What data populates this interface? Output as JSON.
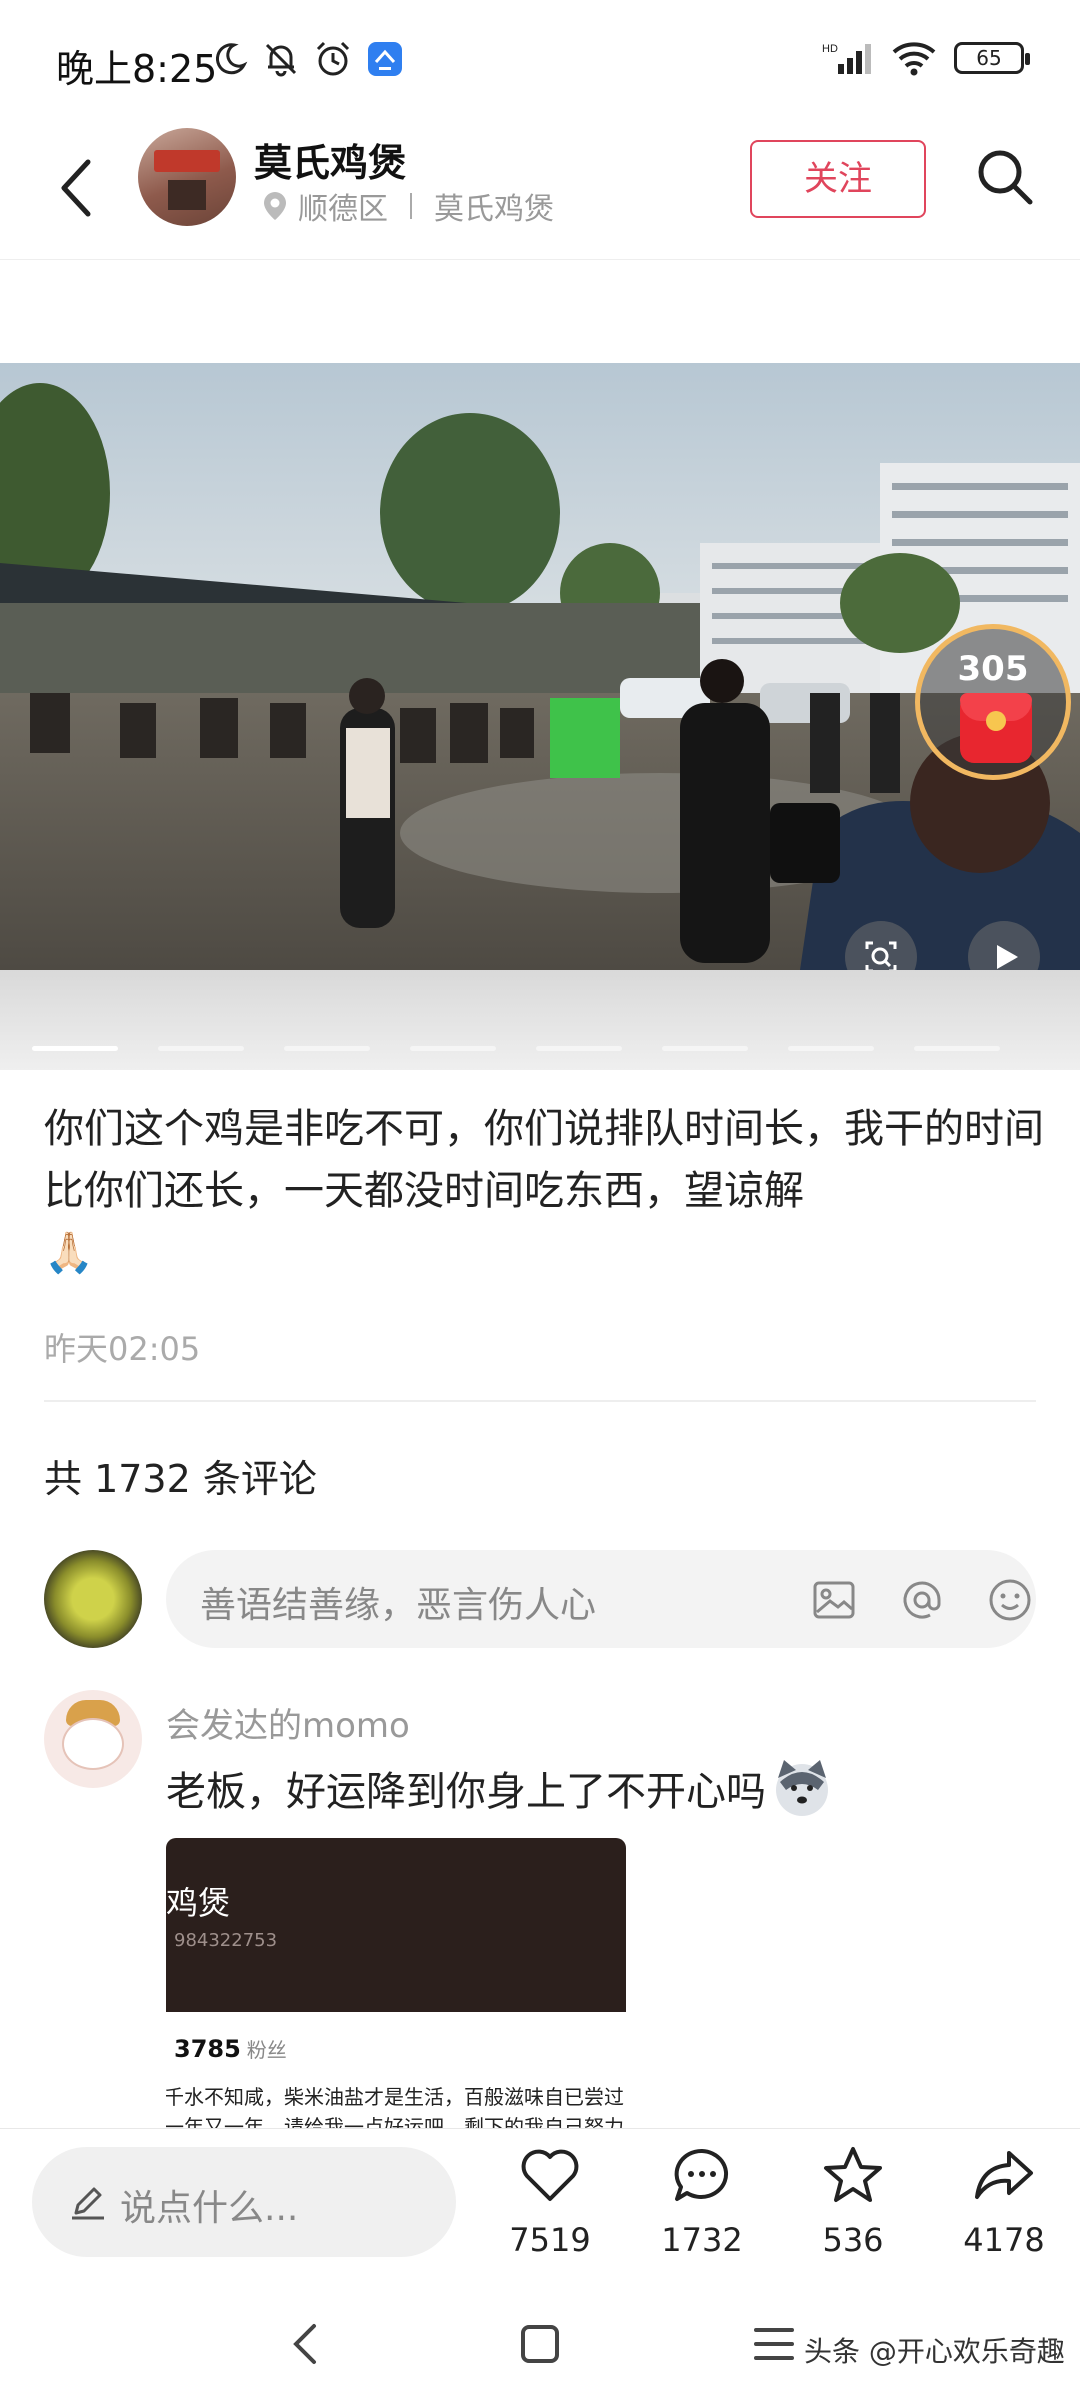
{
  "status_bar": {
    "time": "晚上8:25",
    "battery": "65"
  },
  "header": {
    "shop_name": "莫氏鸡煲",
    "district": "顺德区",
    "location_name": "莫氏鸡煲",
    "follow_label": "关注"
  },
  "photo": {
    "red_packet_count": "305"
  },
  "post": {
    "text": "你们这个鸡是非吃不可，你们说排队时间长，我干的时间比你们还长，一天都没时间吃东西，望谅解",
    "emoji": "🙏🏻",
    "time": "昨天02:05"
  },
  "comments": {
    "count_text": "共 1732 条评论",
    "input_placeholder": "善语结善缘，恶言伤人心",
    "first": {
      "username": "会发达的momo",
      "text": "老板，好运降到你身上了不开心吗",
      "image": {
        "title": "鸡煲",
        "id": "984322753",
        "fans_count": "3785",
        "fans_label": "粉丝",
        "bio_line1": "千水不知咸，柴米油盐才是生活，百般滋味自已尝过",
        "bio_line2": "一年又一年，请给我一点好运吧，剩下的我自己努力"
      }
    }
  },
  "bottom_bar": {
    "say_placeholder": "说点什么...",
    "likes": "7519",
    "comments": "1732",
    "favorites": "536",
    "shares": "4178"
  },
  "watermark": "头条 @开心欢乐奇趣",
  "colors": {
    "accent": "#e0455c",
    "muted": "#999999"
  }
}
